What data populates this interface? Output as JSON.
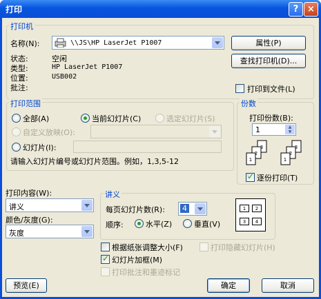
{
  "window": {
    "title": "打印",
    "help": "?",
    "close": "×"
  },
  "printer": {
    "group": "打印机",
    "name_label": "名称(N):",
    "name_value": "\\\\JS\\HP LaserJet P1007",
    "properties": "属性(P)",
    "find": "查找打印机(D)...",
    "status_label": "状态:",
    "status_value": "空闲",
    "type_label": "类型:",
    "type_value": "HP LaserJet P1007",
    "where_label": "位置:",
    "where_value": "USB002",
    "comment_label": "批注:",
    "print_to_file": "打印到文件(L)"
  },
  "range": {
    "group": "打印范围",
    "all": "全部(A)",
    "current": "当前幻灯片(C)",
    "selection": "选定幻灯片(S)",
    "custom_show": "自定义放映(O):",
    "slides": "幻灯片(I):",
    "hint": "请输入幻灯片编号或幻灯片范围。例如，1,3,5-12"
  },
  "copies": {
    "group": "份数",
    "label": "打印份数(B):",
    "value": "1",
    "collate": "逐份打印(T)"
  },
  "print_what": {
    "label": "打印内容(W):",
    "value": "讲义"
  },
  "color": {
    "label": "颜色/灰度(G):",
    "value": "灰度"
  },
  "handouts": {
    "group": "讲义",
    "per_page_label": "每页幻灯片数(R):",
    "per_page_value": "4",
    "order_label": "顺序:",
    "horizontal": "水平(Z)",
    "vertical": "垂直(V)",
    "preview_cells": [
      "1",
      "2",
      "3",
      "4"
    ]
  },
  "options": {
    "scale": "根据纸张调整大小(F)",
    "frame": "幻灯片加框(M)",
    "comments": "打印批注和墨迹标记",
    "hidden": "打印隐藏幻灯片(H)"
  },
  "buttons": {
    "preview": "预览(E)",
    "ok": "确定",
    "cancel": "取消"
  }
}
